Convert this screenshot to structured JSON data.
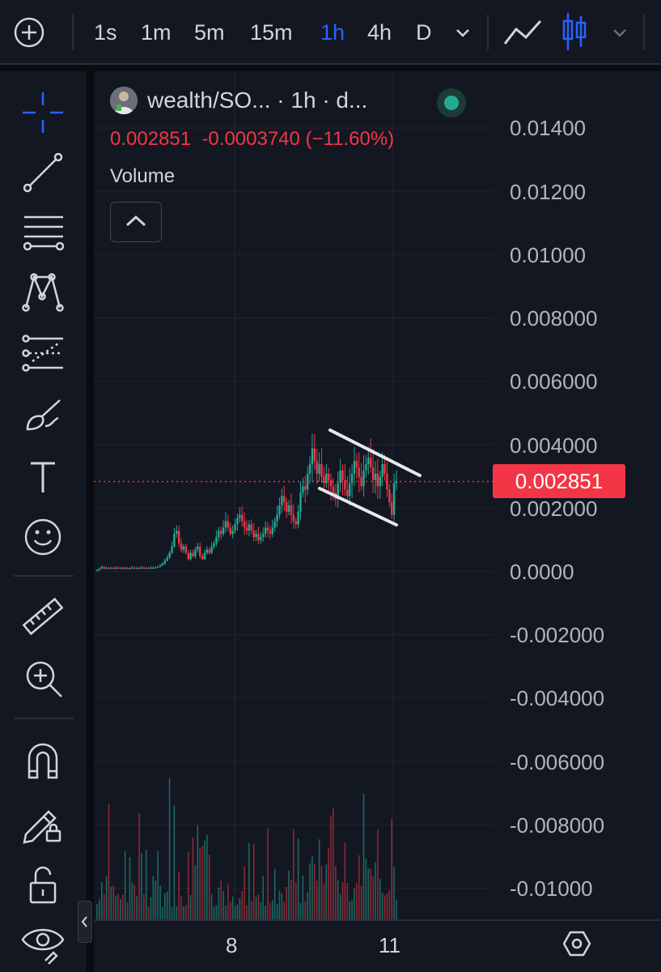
{
  "toolbar": {
    "timeframes": [
      "1s",
      "1m",
      "5m",
      "15m",
      "1h",
      "4h",
      "D"
    ],
    "active_timeframe": "1h",
    "icons": [
      "add-symbol-icon",
      "chevron-down-icon",
      "line-chart-icon",
      "candles-icon",
      "chevron-down-icon"
    ]
  },
  "drawing_tools": [
    "crosshair-icon",
    "trend-line-icon",
    "fib-retracement-icon",
    "pattern-icon",
    "prediction-icon",
    "brush-icon",
    "text-icon",
    "emoji-icon",
    "ruler-icon",
    "zoom-in-icon",
    "magnet-icon",
    "lock-drawings-icon",
    "unlock-icon",
    "eye-icon"
  ],
  "legend": {
    "symbol": "wealth/SO...",
    "interval": "· 1h · d...",
    "ohlc": "0.002851  -0.0003740 (−11.60%)",
    "volume_label": "Volume"
  },
  "price_axis": {
    "labels": [
      "0.01400",
      "0.01200",
      "0.01000",
      "0.008000",
      "0.006000",
      "0.004000",
      "0.002000",
      "0.0000",
      "-0.002000",
      "-0.004000",
      "-0.006000",
      "-0.008000",
      "-0.01000"
    ],
    "current_price": "0.002851"
  },
  "time_axis": {
    "labels": [
      "8",
      "11"
    ]
  },
  "colors": {
    "background": "#131722",
    "up": "#22ab94",
    "down": "#f23645",
    "accent": "#2962ff"
  },
  "chart_data": {
    "type": "candlestick",
    "interval": "1h",
    "ylim": [
      -0.011,
      0.015
    ],
    "current_price": 0.002851,
    "x_ticks": [
      "8",
      "11"
    ],
    "close_series": [
      5e-05,
      0.0001,
      0.00015,
      0.0001,
      0.00012,
      0.0001,
      0.00012,
      0.0001,
      0.00013,
      0.00011,
      0.00012,
      0.0001,
      0.00012,
      0.0001,
      0.00011,
      0.00013,
      0.0001,
      0.00012,
      0.00011,
      0.00013,
      0.00012,
      0.00012,
      0.00011,
      0.00013,
      0.00013,
      0.00014,
      0.00016,
      0.0002,
      0.00026,
      0.00035,
      0.00045,
      0.0006,
      0.0008,
      0.0012,
      0.0013,
      0.0009,
      0.0007,
      0.0008,
      0.0006,
      0.0004,
      0.0006,
      0.0005,
      0.0007,
      0.0008,
      0.0005,
      0.0004,
      0.0006,
      0.0007,
      0.0006,
      0.0008,
      0.0009,
      0.0011,
      0.0013,
      0.0012,
      0.0014,
      0.0016,
      0.0014,
      0.0012,
      0.0013,
      0.0015,
      0.0017,
      0.0018,
      0.0016,
      0.0014,
      0.0013,
      0.0015,
      0.0013,
      0.0011,
      0.0012,
      0.001,
      0.0011,
      0.0012,
      0.0014,
      0.0013,
      0.0012,
      0.0014,
      0.0016,
      0.0018,
      0.0021,
      0.0024,
      0.0022,
      0.0019,
      0.0021,
      0.0018,
      0.0016,
      0.0015,
      0.0019,
      0.0025,
      0.0027,
      0.0026,
      0.0031,
      0.0034,
      0.0039,
      0.0035,
      0.0031,
      0.0034,
      0.003,
      0.0028,
      0.0031,
      0.0029,
      0.0027,
      0.0025,
      0.0023,
      0.0028,
      0.0032,
      0.0029,
      0.0026,
      0.0024,
      0.0028,
      0.0031,
      0.0035,
      0.0033,
      0.003,
      0.0027,
      0.0032,
      0.0034,
      0.0036,
      0.0033,
      0.0029,
      0.0031,
      0.0027,
      0.003,
      0.0034,
      0.0031,
      0.0026,
      0.0022,
      0.0018,
      0.0028,
      0.002851
    ]
  }
}
